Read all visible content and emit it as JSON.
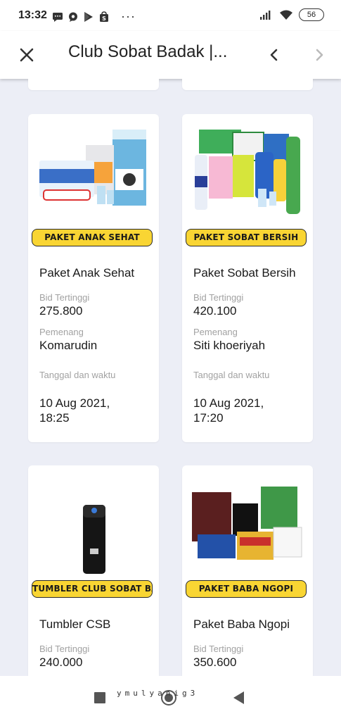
{
  "status_bar": {
    "time": "13:32",
    "overflow_dots": "···",
    "battery": "56",
    "left_icons": [
      "message-icon",
      "chat-icon",
      "play-store-icon",
      "shopping-bag-icon"
    ],
    "right_icons": [
      "signal-icon",
      "wifi-icon",
      "battery-icon"
    ]
  },
  "toolbar": {
    "title": "Club Sobat Badak |...",
    "close_icon": "close-icon",
    "back_icon": "chevron-left-icon",
    "forward_icon": "chevron-right-icon"
  },
  "products": [
    {
      "banner": "PAKET ANAK SEHAT",
      "name": "Paket Anak Sehat",
      "bid_label": "Bid Tertinggi",
      "bid_value": "275.800",
      "winner_label": "Pemenang",
      "winner": "Komarudin",
      "date_label": "Tanggal dan waktu",
      "date_value": "10 Aug 2021, 18:25"
    },
    {
      "banner": "PAKET SOBAT BERSIH",
      "name": "Paket Sobat Bersih",
      "bid_label": "Bid Tertinggi",
      "bid_value": "420.100",
      "winner_label": "Pemenang",
      "winner": "Siti khoeriyah",
      "date_label": "Tanggal dan waktu",
      "date_value": "10 Aug 2021, 17:20"
    },
    {
      "banner": "TUMBLER CLUB SOBAT BADAK",
      "name": "Tumbler CSB",
      "bid_label": "Bid Tertinggi",
      "bid_value": "240.000"
    },
    {
      "banner": "PAKET BABA NGOPI",
      "name": "Paket Baba Ngopi",
      "bid_label": "Bid Tertinggi",
      "bid_value": "350.600"
    }
  ],
  "nav_bar": {
    "watermark": "ymulyanig3",
    "icons": [
      "recent-apps-icon",
      "home-icon",
      "back-icon"
    ]
  },
  "colors": {
    "banner_yellow": "#f9d533",
    "background": "#eceef6",
    "label_gray": "#a2a2a2"
  }
}
